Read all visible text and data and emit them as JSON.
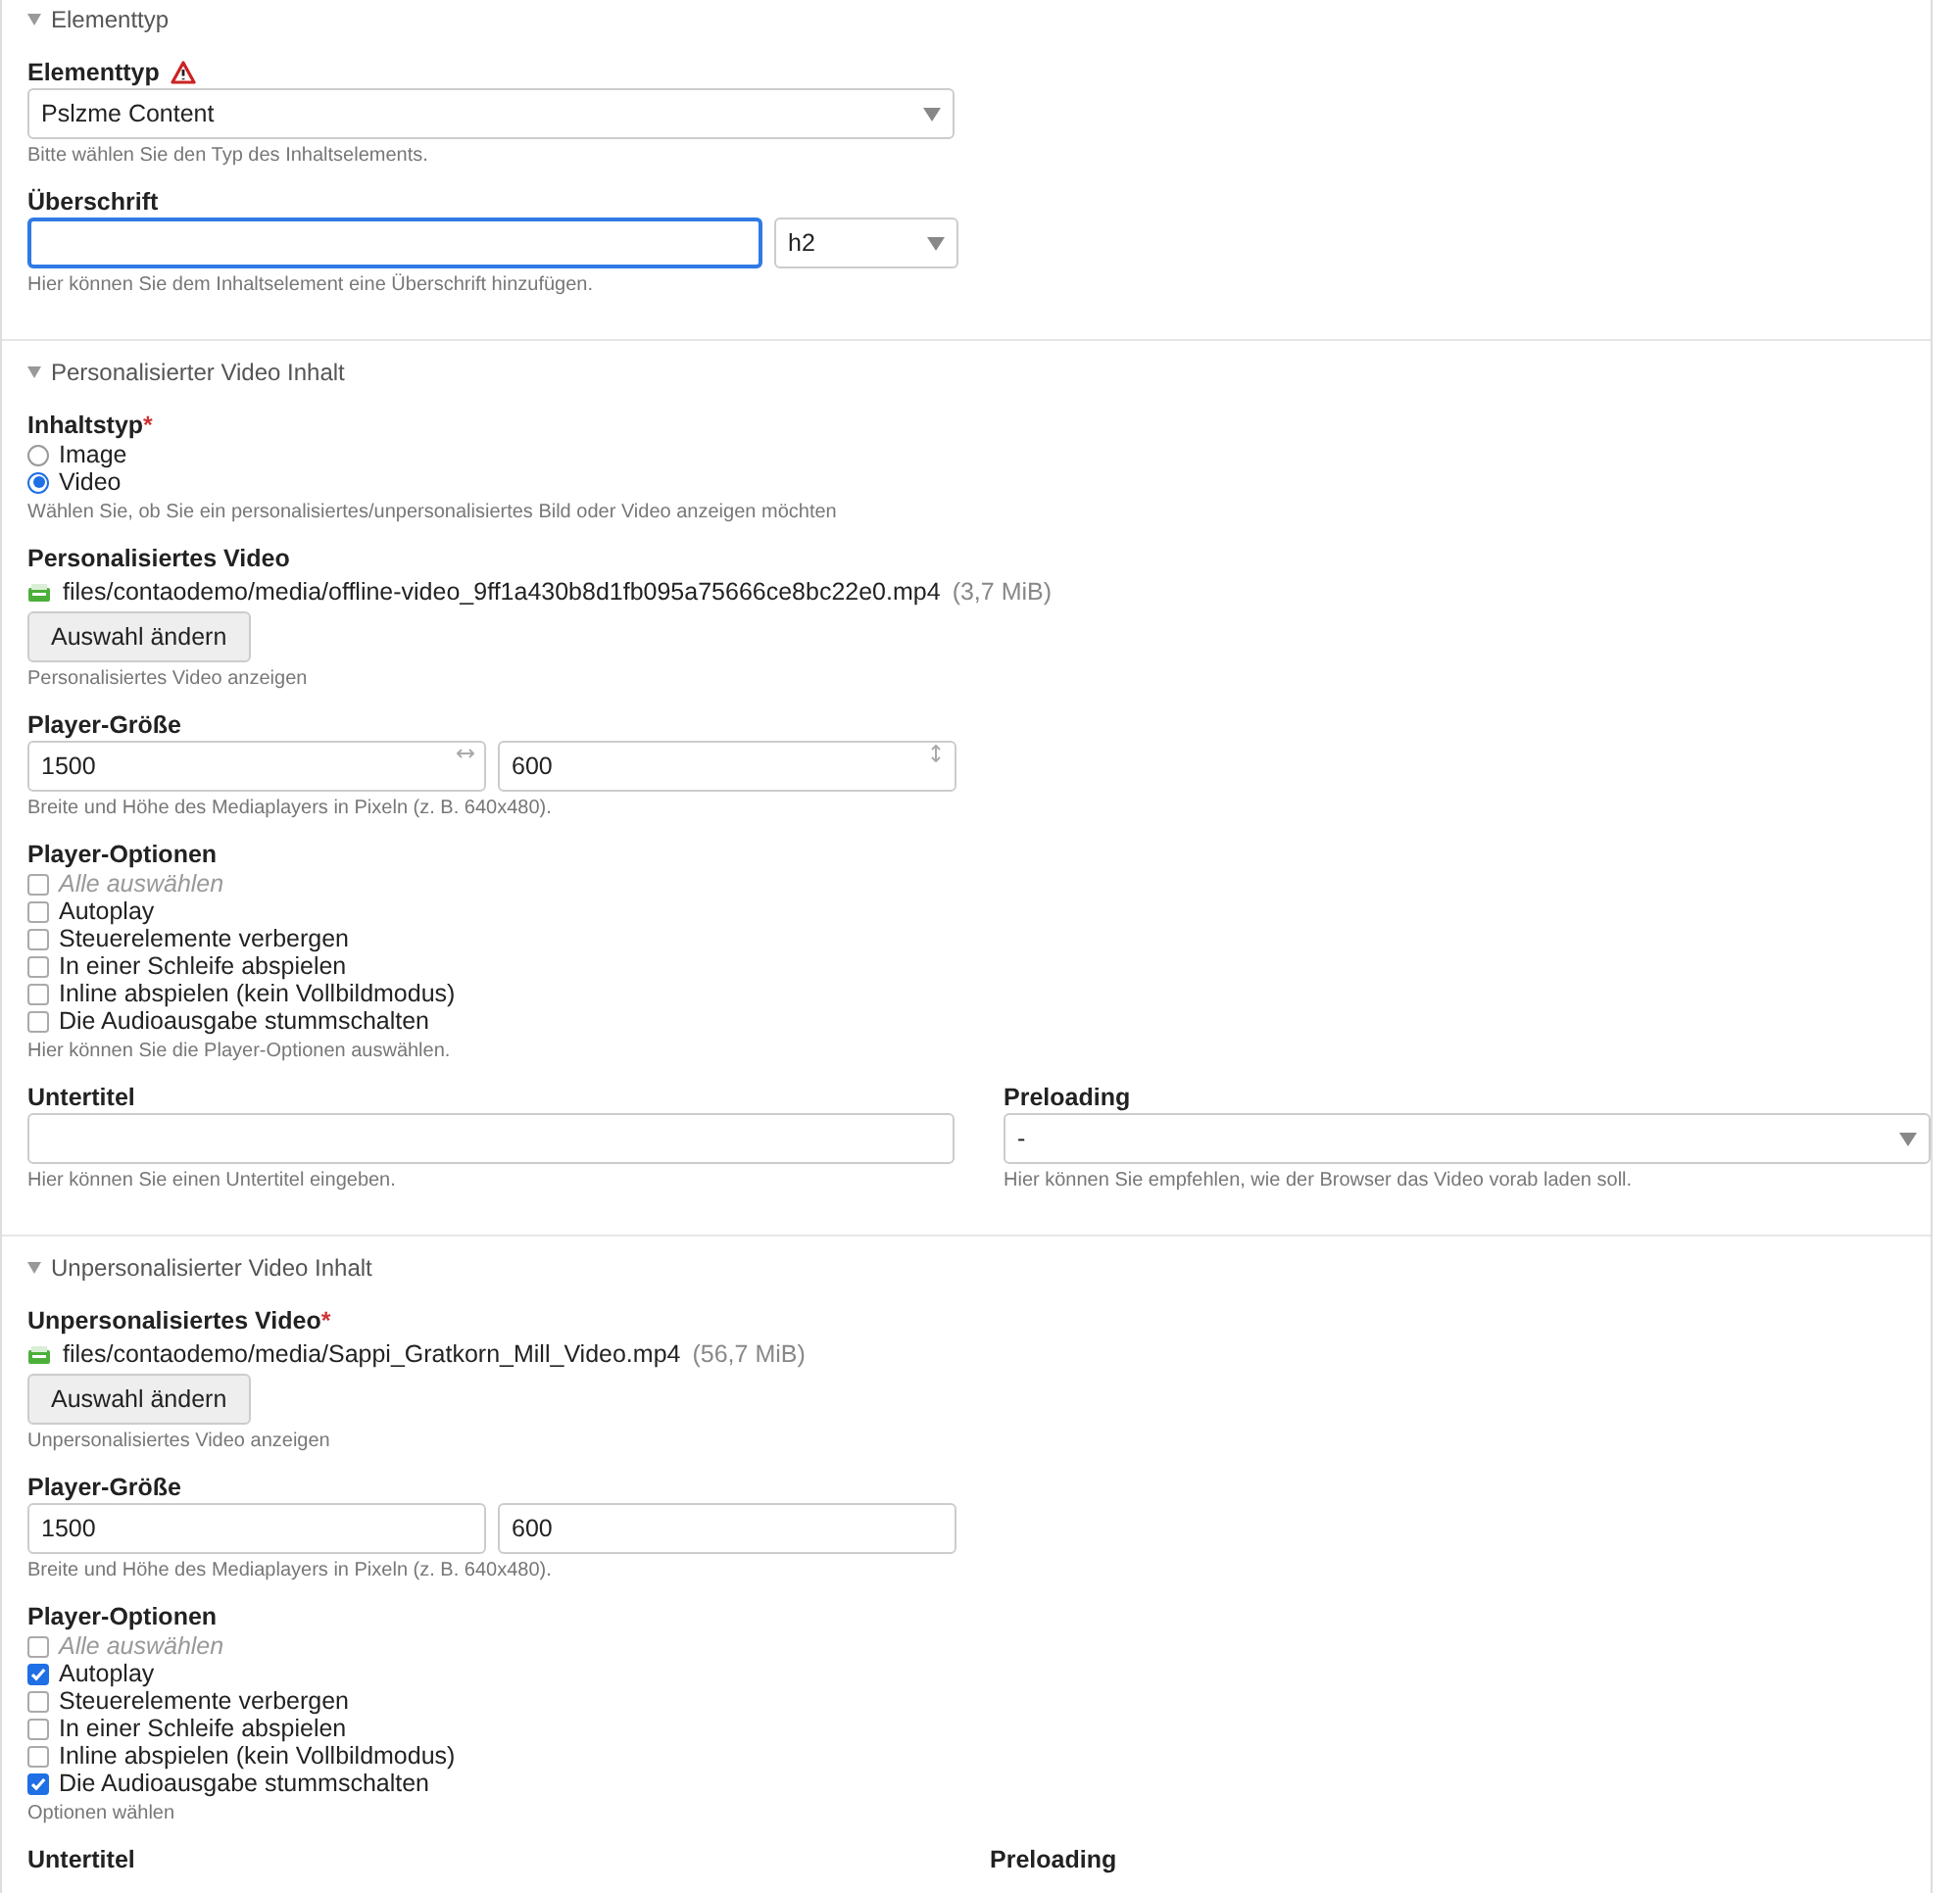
{
  "sections": [
    {
      "legend": "Elementtyp",
      "expanded": true,
      "fields": [
        {
          "kind": "select",
          "label": "Elementtyp",
          "warning": true,
          "value": "Pslzme Content",
          "hint": "Bitte wählen Sie den Typ des Inhaltselements."
        },
        {
          "kind": "heading",
          "label": "Überschrift",
          "focused": true,
          "select_value": "h2",
          "hint": "Hier können Sie dem Inhaltselement eine Überschrift hinzufügen."
        }
      ]
    },
    {
      "legend": "Personalisierter Video Inhalt",
      "expanded": true,
      "fields": [
        {
          "kind": "radio",
          "label": "Inhaltstyp",
          "required_mark": "*",
          "options": [
            {
              "label": "Image",
              "selected": false
            },
            {
              "label": "Video",
              "selected": true
            }
          ],
          "hint": "Wählen Sie, ob Sie ein personalisiertes/unpersonalisiertes Bild oder Video anzeigen möchten"
        },
        {
          "kind": "file",
          "label": "Personalisiertes Video",
          "file": "files/contaodemo/media/offline-video_9ff1a430b8d1fb095a75666ce8bc22e0.mp4",
          "size": "(3,7 MiB)",
          "button": "Auswahl ändern",
          "hint": "Personalisiertes Video anzeigen"
        },
        {
          "kind": "size",
          "label": "Player-Größe",
          "values": [
            "1500",
            "600"
          ],
          "resizable": true,
          "hint": "Breite und Höhe des Mediaplayers in Pixeln (z. B. 640x480)."
        },
        {
          "kind": "checkboxes",
          "label": "Player-Optionen",
          "select_all": {
            "label": "Alle auswählen",
            "checked": false
          },
          "options": [
            {
              "label": "Autoplay",
              "checked": false
            },
            {
              "label": "Steuerelemente verbergen",
              "checked": false
            },
            {
              "label": "In einer Schleife abspielen",
              "checked": false
            },
            {
              "label": "Inline abspielen (kein Vollbildmodus)",
              "checked": false
            },
            {
              "label": "Die Audioausgabe stummschalten",
              "checked": false
            }
          ],
          "hint": "Hier können Sie die Player-Optionen auswählen."
        },
        {
          "kind": "pair",
          "columns": [
            {
              "kind": "text",
              "label": "Untertitel",
              "hint": "Hier können Sie einen Untertitel eingeben."
            },
            {
              "kind": "select",
              "label": "Preloading",
              "value": "-",
              "hint": "Hier können Sie empfehlen, wie der Browser das Video vorab laden soll."
            }
          ]
        }
      ]
    },
    {
      "legend": "Unpersonalisierter Video Inhalt",
      "expanded": true,
      "fields": [
        {
          "kind": "file",
          "label": "Unpersonalisiertes Video",
          "required_mark": "*",
          "file": "files/contaodemo/media/Sappi_Gratkorn_Mill_Video.mp4",
          "size": "(56,7 MiB)",
          "button": "Auswahl ändern",
          "hint": "Unpersonalisiertes Video anzeigen"
        },
        {
          "kind": "size",
          "label": "Player-Größe",
          "values": [
            "1500",
            "600"
          ],
          "hint": "Breite und Höhe des Mediaplayers in Pixeln (z. B. 640x480)."
        },
        {
          "kind": "checkboxes",
          "label": "Player-Optionen",
          "select_all": {
            "label": "Alle auswählen",
            "checked": false
          },
          "options": [
            {
              "label": "Autoplay",
              "checked": true
            },
            {
              "label": "Steuerelemente verbergen",
              "checked": false
            },
            {
              "label": "In einer Schleife abspielen",
              "checked": false
            },
            {
              "label": "Inline abspielen (kein Vollbildmodus)",
              "checked": false
            },
            {
              "label": "Die Audioausgabe stummschalten",
              "checked": true
            }
          ],
          "hint": "Optionen wählen"
        },
        {
          "kind": "pair",
          "columns": [
            {
              "kind": "label",
              "label": "Untertitel"
            },
            {
              "kind": "label",
              "label": "Preloading"
            }
          ]
        }
      ]
    }
  ]
}
